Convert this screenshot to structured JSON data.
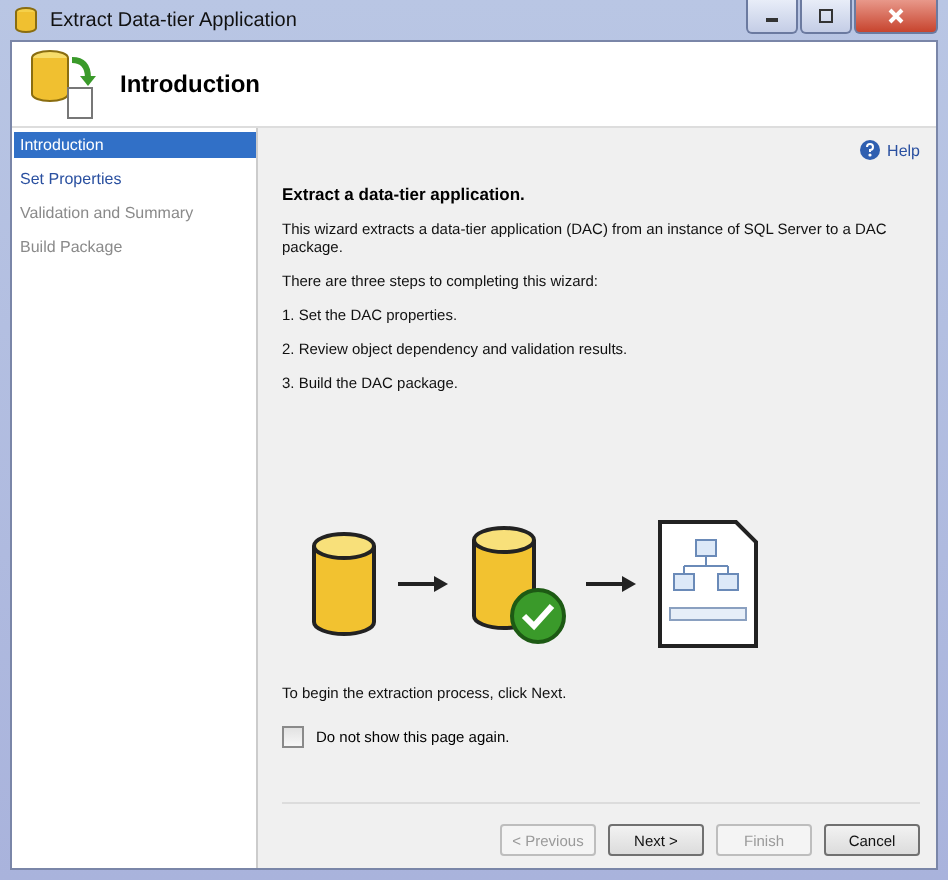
{
  "window": {
    "title": "Extract Data-tier Application"
  },
  "header": {
    "title": "Introduction"
  },
  "sidebar": {
    "items": [
      {
        "label": "Introduction",
        "selected": true,
        "disabled": false
      },
      {
        "label": "Set Properties",
        "selected": false,
        "disabled": false
      },
      {
        "label": "Validation and Summary",
        "selected": false,
        "disabled": true
      },
      {
        "label": "Build Package",
        "selected": false,
        "disabled": true
      }
    ]
  },
  "help": {
    "label": "Help"
  },
  "content": {
    "heading": "Extract a data-tier application.",
    "description": "This wizard extracts a data-tier application (DAC) from an instance of SQL Server to a DAC package.",
    "steps_intro": "There are three steps to completing this wizard:",
    "steps": [
      "1. Set the DAC properties.",
      "2. Review object dependency and validation results.",
      "3. Build the DAC package."
    ],
    "footer_text": "To begin the extraction process, click Next.",
    "checkbox": {
      "label": "Do not show this page again.",
      "checked": false
    }
  },
  "buttons": [
    {
      "label": "< Previous",
      "disabled": true
    },
    {
      "label": "Next >",
      "disabled": false
    },
    {
      "label": "Finish",
      "disabled": true
    },
    {
      "label": "Cancel",
      "disabled": false
    }
  ]
}
